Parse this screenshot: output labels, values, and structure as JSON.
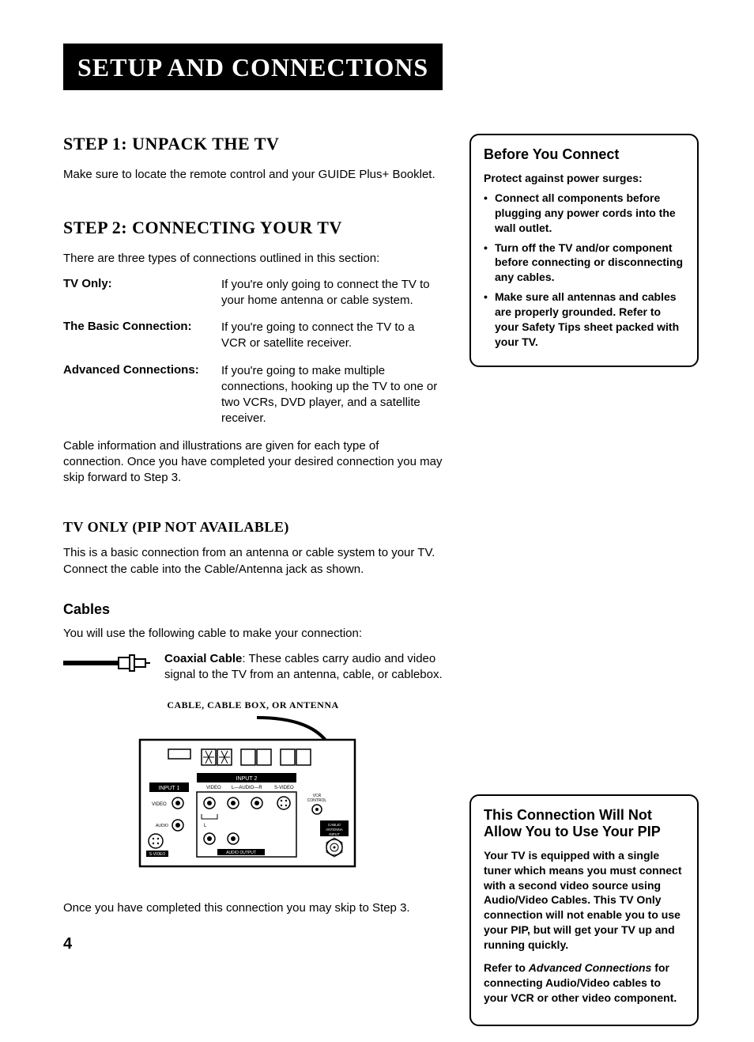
{
  "banner": "Setup and Connections",
  "step1": {
    "heading": "Step 1: Unpack the TV",
    "body": "Make sure to locate the remote control and your GUIDE Plus+ Booklet."
  },
  "step2": {
    "heading": "Step 2: Connecting Your TV",
    "intro": "There are three types of connections outlined in this section:",
    "types": [
      {
        "term": "TV Only:",
        "desc": "If you're only going to connect the TV to your home antenna or cable system."
      },
      {
        "term": "The Basic Connection:",
        "desc": "If you're going to connect the TV to a VCR or satellite receiver."
      },
      {
        "term": "Advanced Connections:",
        "desc": "If you're going to make multiple connections, hooking up the TV to one or two VCRs, DVD player, and a satellite receiver."
      }
    ],
    "outro": "Cable information and illustrations are given for each type of connection. Once you have completed your desired connection you may skip forward to Step 3."
  },
  "tvonly": {
    "heading": "TV Only (PIP not available)",
    "body": "This is a basic connection from an antenna or cable system to your TV. Connect the cable into the Cable/Antenna jack as shown."
  },
  "cables": {
    "heading": "Cables",
    "intro": "You will use the following cable to make your connection:",
    "coax_label": "Coaxial Cable",
    "coax_desc": ": These cables carry audio and video signal to the TV from an antenna, cable, or cablebox."
  },
  "diagram": {
    "caption": "Cable, Cable Box, or Antenna",
    "labels": {
      "input1": "INPUT 1",
      "input2": "INPUT 2",
      "video": "VIDEO",
      "audio_l": "L",
      "audio": "AUDIO",
      "audio_r": "R",
      "svideo": "S-VIDEO",
      "vcr": "VCR CONTROL",
      "cable_ant": "CABLE/ ANTENNA INPUT",
      "audio_out": "AUDIO OUTPUT"
    }
  },
  "afterdiagram": "Once you have completed this connection you may skip to Step 3.",
  "callout1": {
    "title": "Before You Connect",
    "intro": "Protect against power surges:",
    "items": [
      "Connect all components before plugging any power cords into the wall outlet.",
      "Turn off the TV and/or component before connecting or disconnecting any cables.",
      "Make sure all antennas and cables are properly grounded. Refer to your Safety Tips sheet packed with your TV."
    ]
  },
  "callout2": {
    "title": "This Connection Will Not Allow You to Use Your PIP",
    "p1": "Your TV is equipped with a single tuner which means you must connect with a second video source using Audio/Video Cables. This TV Only connection will not enable you to use your PIP, but will get your TV up and running quickly.",
    "p2a": "Refer to ",
    "p2em": "Advanced Connections",
    "p2b": " for connecting Audio/Video cables to your VCR or other video component."
  },
  "page": "4"
}
